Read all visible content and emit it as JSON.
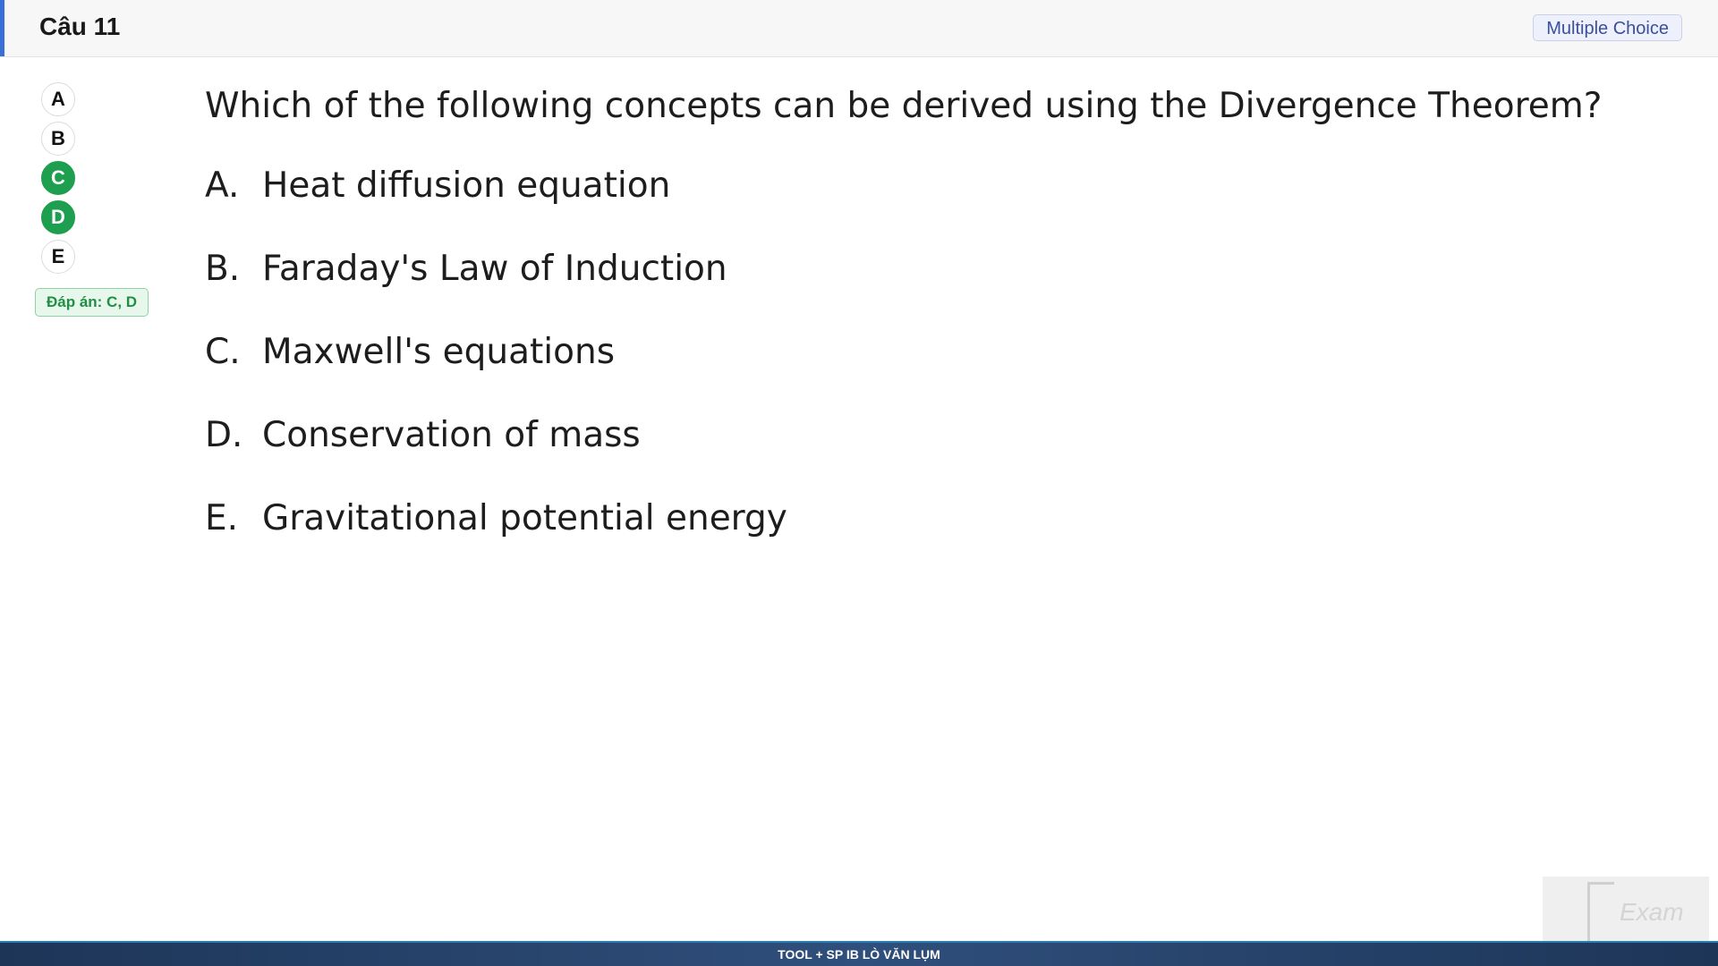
{
  "header": {
    "title": "Câu 11",
    "question_type": "Multiple Choice"
  },
  "options_nav": [
    {
      "letter": "A",
      "selected": false
    },
    {
      "letter": "B",
      "selected": false
    },
    {
      "letter": "C",
      "selected": true
    },
    {
      "letter": "D",
      "selected": true
    },
    {
      "letter": "E",
      "selected": false
    }
  ],
  "answer_label": "Đáp án: C, D",
  "question": "Which of the following concepts can be derived using the Divergence Theorem?",
  "choices": [
    {
      "letter": "A.",
      "text": "Heat diffusion equation"
    },
    {
      "letter": "B.",
      "text": "Faraday's Law of Induction"
    },
    {
      "letter": "C.",
      "text": "Maxwell's equations"
    },
    {
      "letter": "D.",
      "text": "Conservation of mass"
    },
    {
      "letter": "E.",
      "text": "Gravitational potential energy"
    }
  ],
  "footer_text": "TOOL + SP IB LÒ VĂN LỤM",
  "logo_text": "Exam",
  "colors": {
    "accent": "#3b6fd8",
    "selected": "#1e9e4f",
    "answer": "#1f8f43"
  }
}
